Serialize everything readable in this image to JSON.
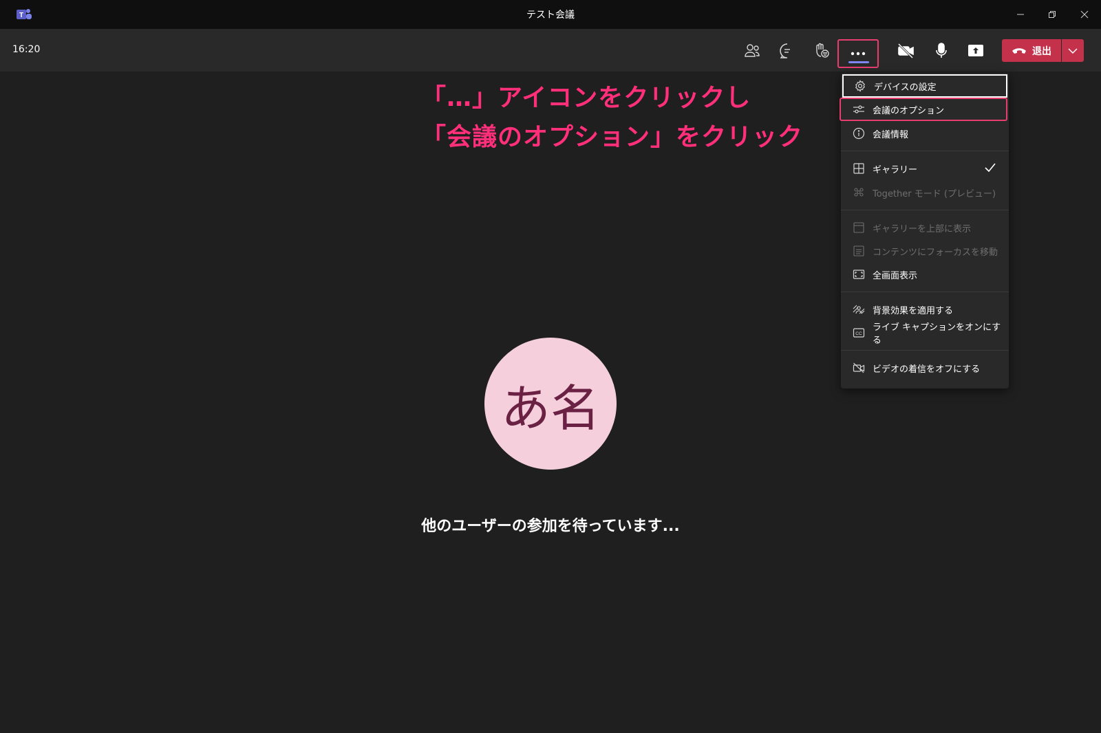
{
  "window": {
    "title": "テスト会議",
    "controls": [
      "minimize",
      "restore",
      "close"
    ]
  },
  "toolbar": {
    "clock": "16:20",
    "buttons": [
      "participants-icon",
      "chat-icon",
      "reactions-icon",
      "more-actions-icon",
      "camera-off-icon",
      "microphone-icon",
      "share-screen-icon"
    ],
    "leave_label": "退出"
  },
  "annotation": {
    "line1": "「…」アイコンをクリックし",
    "line2": "「会議のオプション」をクリック",
    "color": "#ff2f7a"
  },
  "menu": {
    "items": [
      {
        "label": "デバイスの設定",
        "icon": "gear-icon",
        "enabled": true
      },
      {
        "label": "会議のオプション",
        "icon": "sliders-icon",
        "enabled": true
      },
      {
        "label": "会議情報",
        "icon": "info-icon",
        "enabled": true
      },
      {
        "label": "ギャラリー",
        "icon": "grid-icon",
        "enabled": true,
        "checked": true
      },
      {
        "label": "Together モード (プレビュー)",
        "icon": "people-icon",
        "enabled": false
      },
      {
        "label": "ギャラリーを上部に表示",
        "icon": "gallery-top-icon",
        "enabled": false
      },
      {
        "label": "コンテンツにフォーカスを移動",
        "icon": "focus-icon",
        "enabled": false
      },
      {
        "label": "全画面表示",
        "icon": "fullscreen-icon",
        "enabled": true
      },
      {
        "label": "背景効果を適用する",
        "icon": "background-effects-icon",
        "enabled": true
      },
      {
        "label": "ライブ キャプションをオンにする",
        "icon": "cc-icon",
        "enabled": true
      },
      {
        "label": "ビデオの着信をオフにする",
        "icon": "video-off-icon",
        "enabled": true
      }
    ]
  },
  "main": {
    "avatar_initials": "あ名",
    "waiting_text": "他のユーザーの参加を待っています..."
  },
  "colors": {
    "accent": "#7f85f5",
    "leave": "#c4314b",
    "highlight": "#e83e6f",
    "avatar_bg": "#f5d0dc"
  }
}
